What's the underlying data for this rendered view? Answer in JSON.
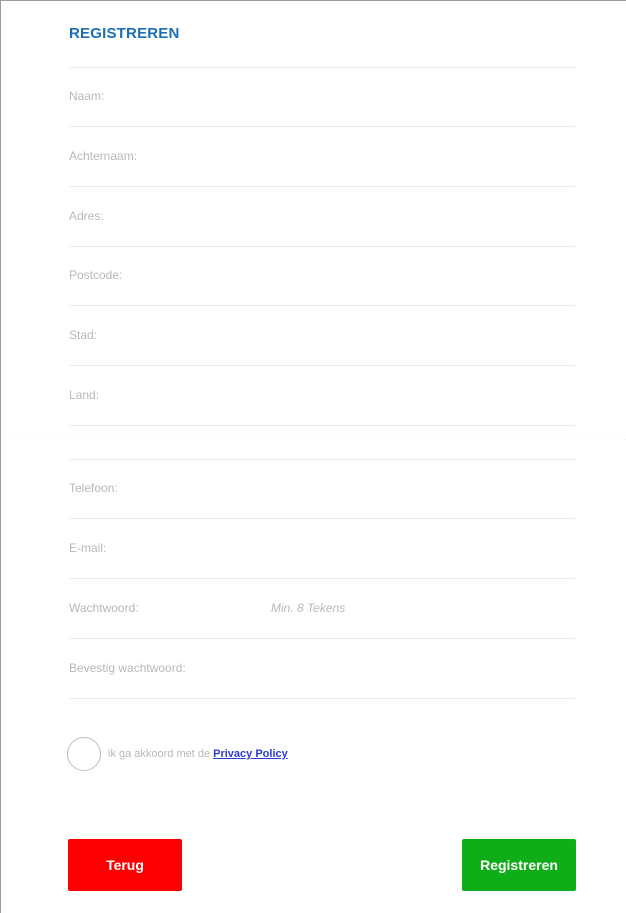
{
  "form": {
    "title": "REGISTREREN",
    "fields": {
      "first_name": "Naam:",
      "last_name": "Achternaam:",
      "address": "Adres:",
      "postcode": "Postcode:",
      "city": "Stad:",
      "country": "Land:",
      "phone": "Telefoon:",
      "email": "E-mail:",
      "password": "Wachtwoord:",
      "password_hint": "Min. 8 Tekens",
      "password_confirm": "Bevestig wachtwoord:"
    },
    "consent": {
      "text": "ik ga akkoord met de",
      "link": "Privacy Policy"
    },
    "buttons": {
      "back": "Terug",
      "register": "Registreren"
    },
    "colors": {
      "title": "#1b6fb8",
      "back_button": "#ff0000",
      "register_button": "#0fae18",
      "link": "#2b3bd9"
    }
  }
}
